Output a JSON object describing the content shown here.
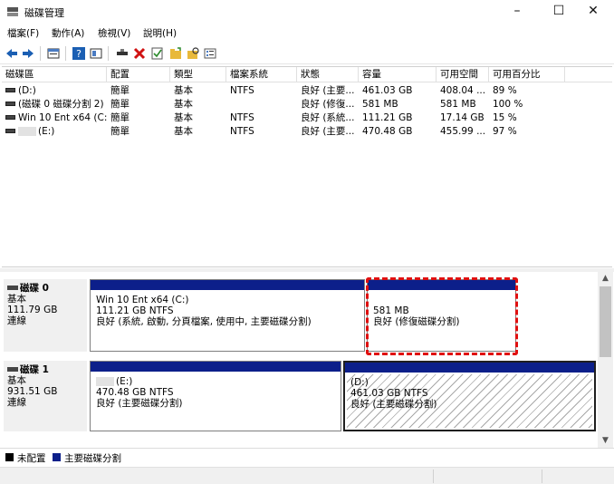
{
  "window": {
    "title": "磁碟管理",
    "min": "–",
    "max": "☐",
    "close": "✕"
  },
  "menu": [
    "檔案(F)",
    "動作(A)",
    "檢視(V)",
    "說明(H)"
  ],
  "toolbar": {
    "icons": [
      "back-icon",
      "forward-icon",
      "properties-icon",
      "help-icon",
      "view-icon",
      "connect-icon",
      "delete-icon",
      "check-icon",
      "folder-icon",
      "search-folder-icon",
      "list-icon"
    ]
  },
  "volume_list": {
    "headers": [
      "磁碟區",
      "配置",
      "類型",
      "檔案系統",
      "狀態",
      "容量",
      "可用空間",
      "可用百分比"
    ],
    "rows": [
      {
        "volume": "(D:)",
        "layout": "簡單",
        "type": "基本",
        "fs": "NTFS",
        "status": "良好 (主要...",
        "capacity": "461.03 GB",
        "free": "408.04 ...",
        "pct": "89 %"
      },
      {
        "volume": "(磁碟 0 磁碟分割 2)",
        "layout": "簡單",
        "type": "基本",
        "fs": "",
        "status": "良好 (修復...",
        "capacity": "581 MB",
        "free": "581 MB",
        "pct": "100 %"
      },
      {
        "volume": "Win 10 Ent x64 (C:)",
        "layout": "簡單",
        "type": "基本",
        "fs": "NTFS",
        "status": "良好 (系統...",
        "capacity": "111.21 GB",
        "free": "17.14 GB",
        "pct": "15 %"
      },
      {
        "volume": "(E:)",
        "layout": "簡單",
        "type": "基本",
        "fs": "NTFS",
        "status": "良好 (主要...",
        "capacity": "470.48 GB",
        "free": "455.99 ...",
        "pct": "97 %"
      }
    ]
  },
  "disks": [
    {
      "name": "磁碟 0",
      "type": "基本",
      "size": "111.79 GB",
      "state": "連線",
      "partitions": [
        {
          "title": "Win 10 Ent x64  (C:)",
          "size": "111.21 GB NTFS",
          "status": "良好 (系統, 啟動, 分頁檔案, 使用中, 主要磁碟分割)"
        },
        {
          "title": "",
          "size": "581 MB",
          "status": "良好 (修復磁碟分割)"
        }
      ]
    },
    {
      "name": "磁碟 1",
      "type": "基本",
      "size": "931.51 GB",
      "state": "連線",
      "partitions": [
        {
          "title": "(E:)",
          "size": "470.48 GB NTFS",
          "status": "良好 (主要磁碟分割)"
        },
        {
          "title": "(D:)",
          "size": "461.03 GB NTFS",
          "status": "良好 (主要磁碟分割)"
        }
      ]
    }
  ],
  "legend": {
    "unallocated": "未配置",
    "primary": "主要磁碟分割"
  },
  "colors": {
    "primary_bar": "#0c1f8a",
    "unallocated": "#000000",
    "highlight": "#e01010"
  }
}
